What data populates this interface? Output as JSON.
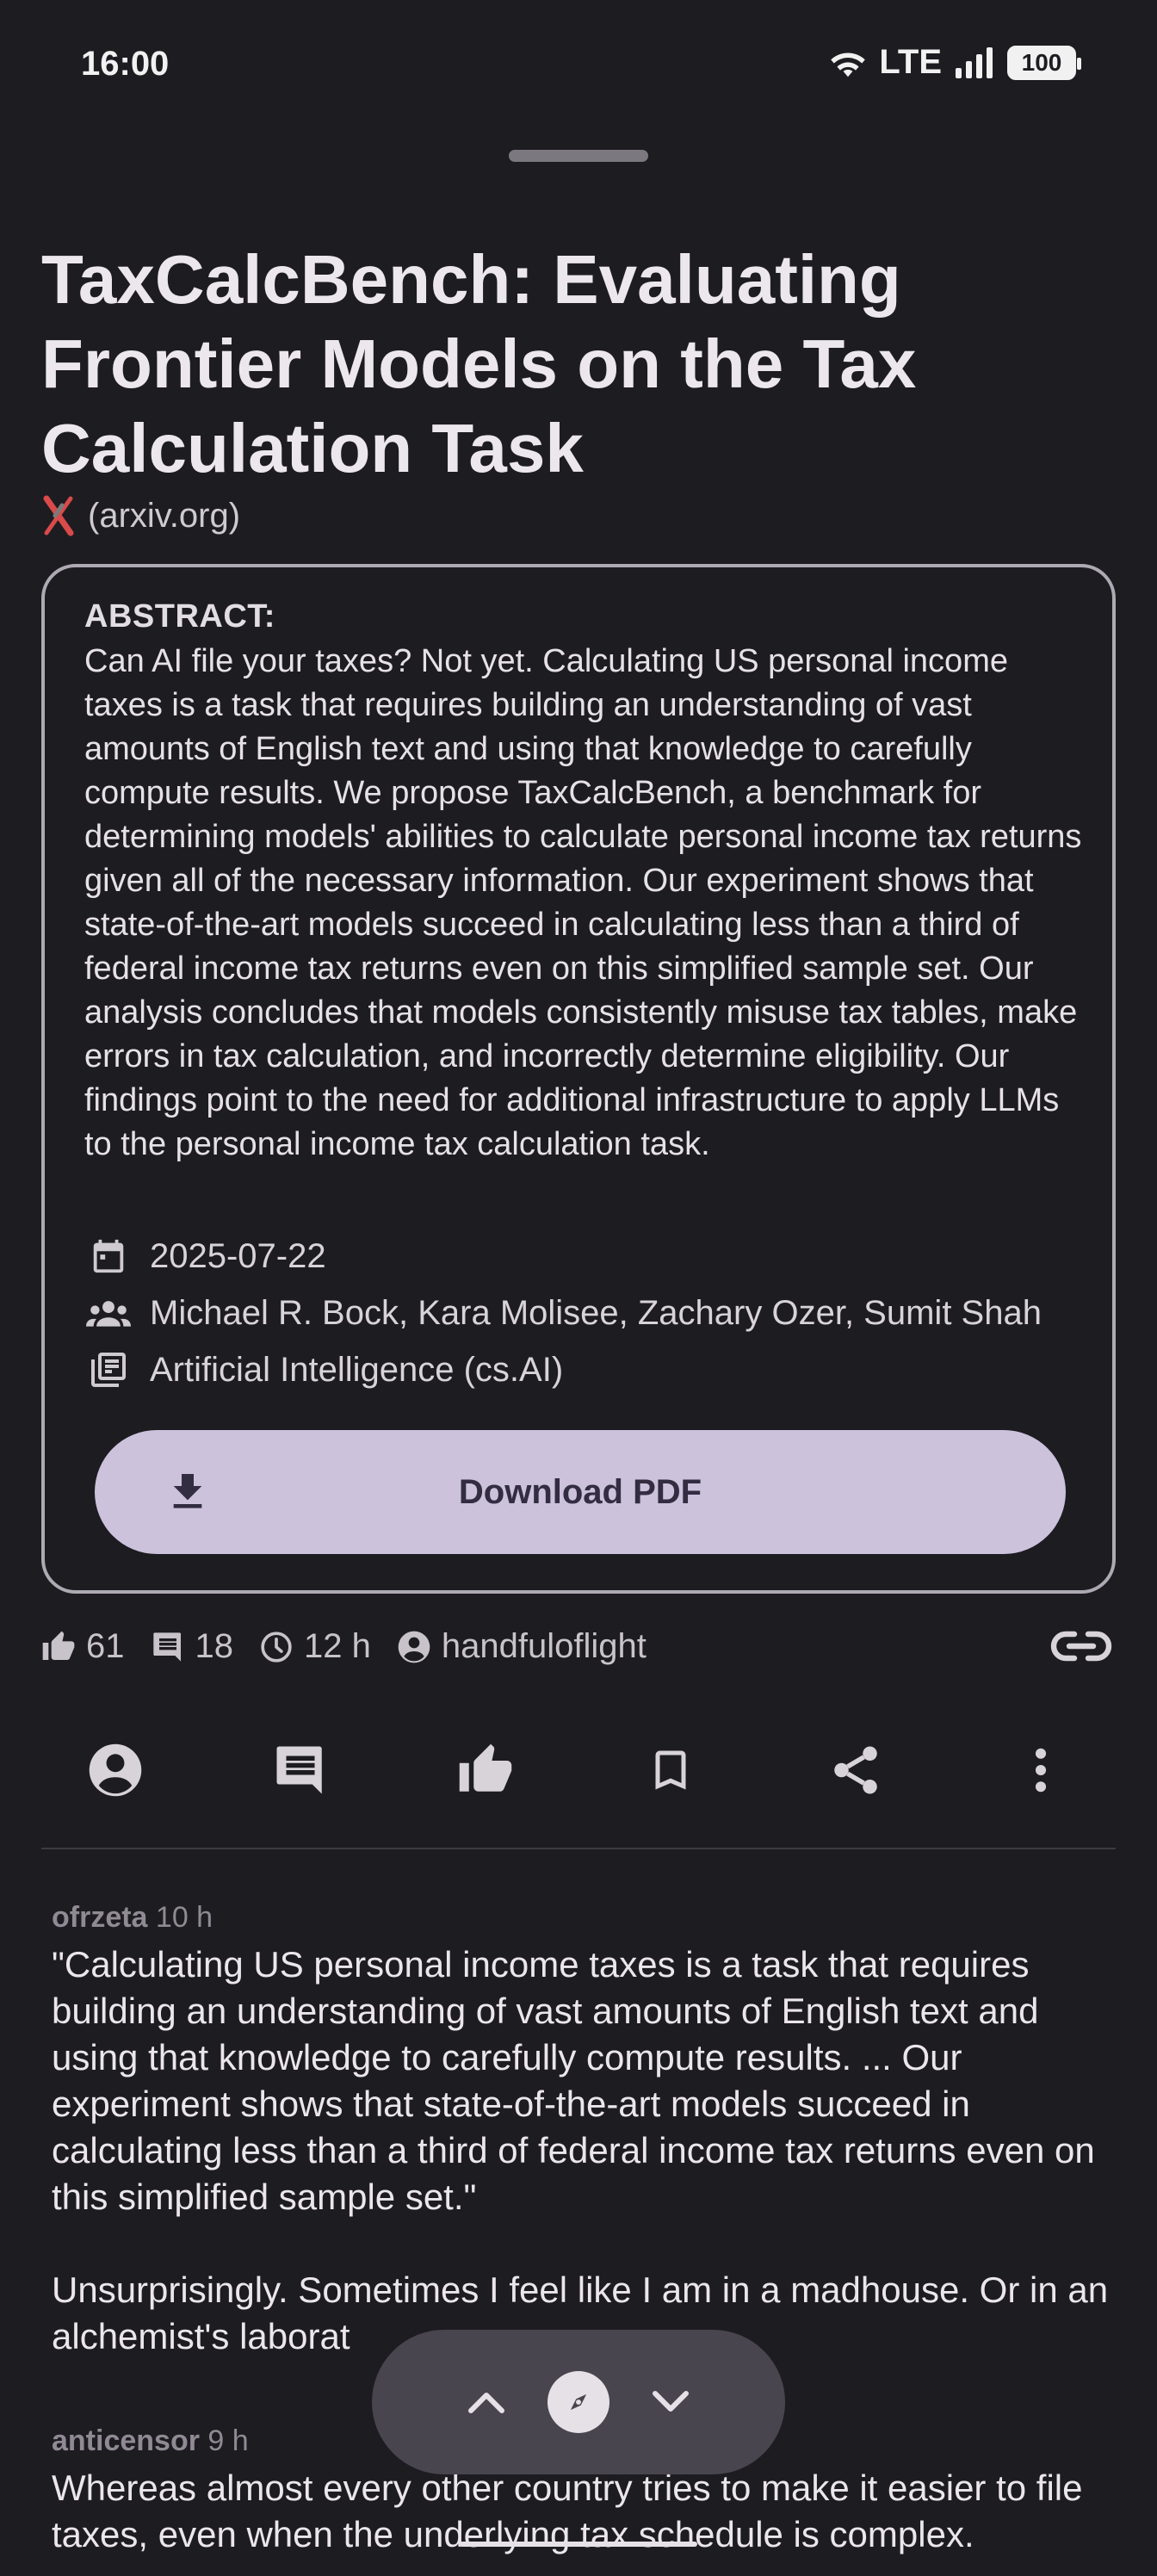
{
  "status_bar": {
    "time": "16:00",
    "network": "LTE",
    "battery": "100"
  },
  "paper": {
    "title": "TaxCalcBench: Evaluating Frontier Models on the Tax Calculation Task",
    "source": "(arxiv.org)",
    "abstract_label": "ABSTRACT:",
    "abstract": "Can AI file your taxes? Not yet. Calculating US personal income taxes is a task that requires building an understanding of vast amounts of English text and using that knowledge to carefully compute results. We propose TaxCalcBench, a benchmark for determining models' abilities to calculate personal income tax returns given all of the necessary information. Our experiment shows that state-of-the-art models succeed in calculating less than a third of federal income tax returns even on this simplified sample set. Our analysis concludes that models consistently misuse tax tables, make errors in tax calculation, and incorrectly determine eligibility. Our findings point to the need for additional infrastructure to apply LLMs to the personal income tax calculation task.",
    "date": "2025-07-22",
    "authors": "Michael R. Bock, Kara Molisee, Zachary Ozer, Sumit Shah",
    "category": "Artificial Intelligence (cs.AI)",
    "download_label": "Download PDF"
  },
  "stats": {
    "likes": "61",
    "comments": "18",
    "age": "12 h",
    "user": "handfuloflight"
  },
  "icons": {
    "source": "x-icon",
    "date": "calendar-icon",
    "authors": "people-icon",
    "category": "library-icon",
    "download": "download-icon",
    "likes": "thumb-up-icon",
    "comments": "comment-icon",
    "age": "clock-icon",
    "user": "account-icon",
    "link": "link-icon"
  },
  "actions": [
    "account",
    "comment",
    "upvote",
    "bookmark",
    "share",
    "more"
  ],
  "comments": [
    {
      "author": "ofrzeta",
      "age": "10 h",
      "text": "\"Calculating US personal income taxes is a task that requires building an understanding of vast amounts of English text and using that knowledge to carefully compute results. ... Our experiment shows that state-of-the-art models succeed in calculating less than a third of federal income tax returns even on this simplified sample set.\"\n\nUnsurprisingly. Sometimes I feel like I am in a madhouse. Or in an alchemist's laborat"
    },
    {
      "author": "anticensor",
      "age": "9 h",
      "text": "Whereas almost every other country tries to make it easier to file taxes, even when the underlying tax schedule is complex."
    }
  ],
  "colors": {
    "background": "#1d1c21",
    "button": "#ccc2dc",
    "fab": "#49454f"
  }
}
